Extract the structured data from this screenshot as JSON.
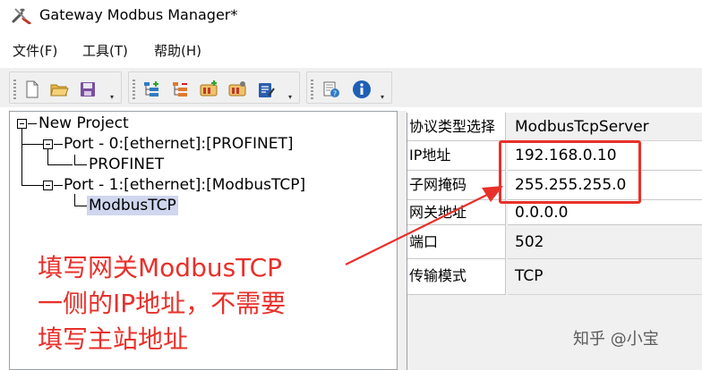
{
  "window": {
    "title": "Gateway Modbus Manager*",
    "app_icon": "tools-icon"
  },
  "menu": {
    "items": [
      "文件(F)",
      "工具(T)",
      "帮助(H)"
    ]
  },
  "toolbar": {
    "groups": [
      [
        "new-file-icon",
        "open-folder-icon",
        "save-icon"
      ],
      [
        "add-port-icon",
        "remove-port-icon",
        "add-device-icon",
        "device-settings-icon",
        "edit-icon"
      ],
      [
        "help-icon",
        "info-icon"
      ]
    ]
  },
  "tree": {
    "root": "New Project",
    "port0": "Port - 0:[ethernet]:[PROFINET]",
    "port0_child": "PROFINET",
    "port1": "Port - 1:[ethernet]:[ModbusTCP]",
    "port1_child": "ModbusTCP"
  },
  "properties": {
    "rows": [
      {
        "key": "协议类型选择",
        "value": "ModbusTcpServer"
      },
      {
        "key": "IP地址",
        "value": "192.168.0.10"
      },
      {
        "key": "子网掩码",
        "value": "255.255.255.0"
      },
      {
        "key": "网关地址",
        "value": "0.0.0.0"
      },
      {
        "key": "端口",
        "value": "502"
      },
      {
        "key": "传输模式",
        "value": "TCP"
      }
    ]
  },
  "annotation": {
    "line1": "填写网关ModbusTCP",
    "line2": "一侧的IP地址，不需要",
    "line3": "填写主站地址",
    "color": "#e8302a"
  },
  "watermark": "知乎 @小宝"
}
